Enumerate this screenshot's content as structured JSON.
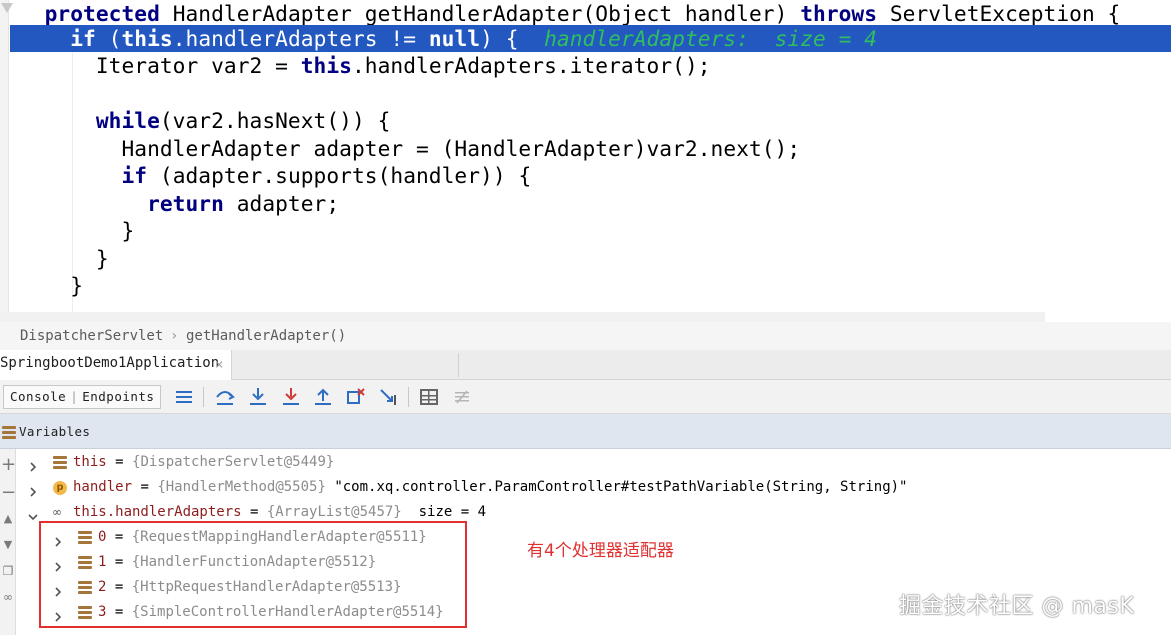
{
  "editor": {
    "lines": [
      {
        "indent": "  ",
        "parts": [
          {
            "t": "protected",
            "k": true
          },
          {
            "t": " HandlerAdapter getHandlerAdapter(Object handler) "
          },
          {
            "t": "throws",
            "k": true
          },
          {
            "t": " ServletException {"
          }
        ]
      },
      {
        "indent": "    ",
        "parts": [
          {
            "t": "if",
            "k": true
          },
          {
            "t": " ("
          },
          {
            "t": "this",
            "k": true
          },
          {
            "t": ".handlerAdapters != "
          },
          {
            "t": "null",
            "k": true
          },
          {
            "t": ") {  "
          },
          {
            "t": "handlerAdapters:  size = 4",
            "h": true
          }
        ]
      },
      {
        "indent": "      ",
        "parts": [
          {
            "t": "Iterator var2 = "
          },
          {
            "t": "this",
            "k": true
          },
          {
            "t": ".handlerAdapters.iterator();"
          }
        ]
      },
      {
        "indent": "",
        "parts": []
      },
      {
        "indent": "      ",
        "parts": [
          {
            "t": "while",
            "k": true
          },
          {
            "t": "(var2.hasNext()) {"
          }
        ]
      },
      {
        "indent": "        ",
        "parts": [
          {
            "t": "HandlerAdapter adapter = (HandlerAdapter)var2.next();"
          }
        ]
      },
      {
        "indent": "        ",
        "parts": [
          {
            "t": "if",
            "k": true
          },
          {
            "t": " (adapter.supports(handler)) {"
          }
        ]
      },
      {
        "indent": "          ",
        "parts": [
          {
            "t": "return",
            "k": true
          },
          {
            "t": " adapter;"
          }
        ]
      },
      {
        "indent": "        ",
        "parts": [
          {
            "t": "}"
          }
        ]
      },
      {
        "indent": "      ",
        "parts": [
          {
            "t": "}"
          }
        ]
      },
      {
        "indent": "    ",
        "parts": [
          {
            "t": "}"
          }
        ]
      }
    ],
    "execution_line": 1
  },
  "breadcrumb": {
    "class_name": "DispatcherServlet",
    "separator": "›",
    "method_name": "getHandlerAdapter()"
  },
  "debug": {
    "run_tab_label": "SpringbootDemo1Application",
    "run_tab_close": "×",
    "console_label": "Console",
    "endpoints_label": "Endpoints",
    "tab_separator": "|",
    "toolbar_icons": [
      "threads-icon",
      "step-over-icon",
      "step-into-icon",
      "force-step-into-icon",
      "step-out-icon",
      "drop-frame-icon",
      "run-to-cursor-icon",
      "evaluate-expression-icon",
      "trace-icon"
    ]
  },
  "variables": {
    "header_label": "Variables",
    "rows": [
      {
        "name": "this",
        "value": "{DispatcherServlet@5449}",
        "icon": "field",
        "expanded": false
      },
      {
        "name": "handler",
        "value": "{HandlerMethod@5505}",
        "extra": "\"com.xq.controller.ParamController#testPathVariable(String, String)\"",
        "icon": "param",
        "expanded": false
      },
      {
        "name": "this.handlerAdapters",
        "value": "{ArrayList@5457}",
        "extra": " size = 4",
        "icon": "watch",
        "expanded": true
      },
      {
        "name": "0",
        "value": "{RequestMappingHandlerAdapter@5511}",
        "icon": "field",
        "expanded": false,
        "child": true
      },
      {
        "name": "1",
        "value": "{HandlerFunctionAdapter@5512}",
        "icon": "field",
        "expanded": false,
        "child": true
      },
      {
        "name": "2",
        "value": "{HttpRequestHandlerAdapter@5513}",
        "icon": "field",
        "expanded": false,
        "child": true
      },
      {
        "name": "3",
        "value": "{SimpleControllerHandlerAdapter@5514}",
        "icon": "field",
        "expanded": false,
        "child": true
      }
    ]
  },
  "annotation": "有4个处理器适配器",
  "watermark": "掘金技术社区 @ masK",
  "colors": {
    "keyword": "#000080",
    "inline_hint": "#2fbf5e",
    "execution_line": "#2358c0",
    "field_name": "#8b1d1d",
    "annotation": "#e03030"
  }
}
